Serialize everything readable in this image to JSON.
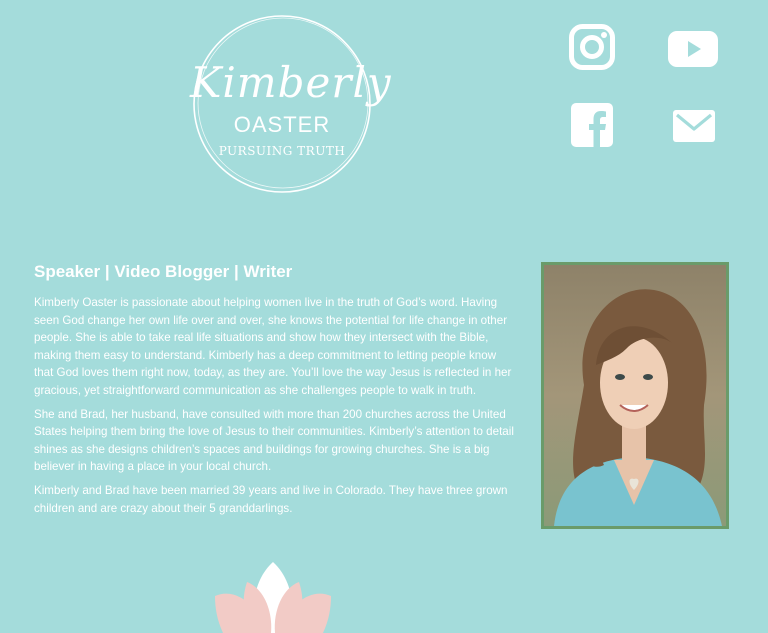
{
  "logo": {
    "script_name": "Kimberly",
    "surname": "OASTER",
    "tagline": "PURSUING TRUTH"
  },
  "social": [
    {
      "name": "instagram",
      "icon": "instagram-icon"
    },
    {
      "name": "youtube",
      "icon": "youtube-icon"
    },
    {
      "name": "facebook",
      "icon": "facebook-icon"
    },
    {
      "name": "email",
      "icon": "envelope-icon"
    }
  ],
  "about": {
    "headline": "Speaker | Video Blogger | Writer",
    "paragraphs": [
      "Kimberly Oaster is passionate about helping women live in the truth of God’s word. Having seen God change her own life over and over, she knows the potential for life change in other people. She is able to take real life situations and show how they intersect with the Bible, making them easy to understand. Kimberly has a deep commitment to letting people know that God loves them right now, today, as they are. You’ll love the way Jesus is reflected in her gracious, yet straightforward communication as she challenges people to walk in truth.",
      "She and Brad, her husband, have consulted with more than 200 churches across the United States helping them bring the love of Jesus to their communities. Kimberly’s attention to detail shines as she designs children’s spaces and buildings for growing churches. She is a big believer in having a place in your local church.",
      "Kimberly and Brad have been married 39 years and live in Colorado. They have three grown children and are crazy about their 5 granddarlings."
    ]
  },
  "colors": {
    "background": "#a4dcdb",
    "text": "#ffffff",
    "photo_border": "#6a9b6a",
    "lotus_pink": "#f2cbc6"
  }
}
